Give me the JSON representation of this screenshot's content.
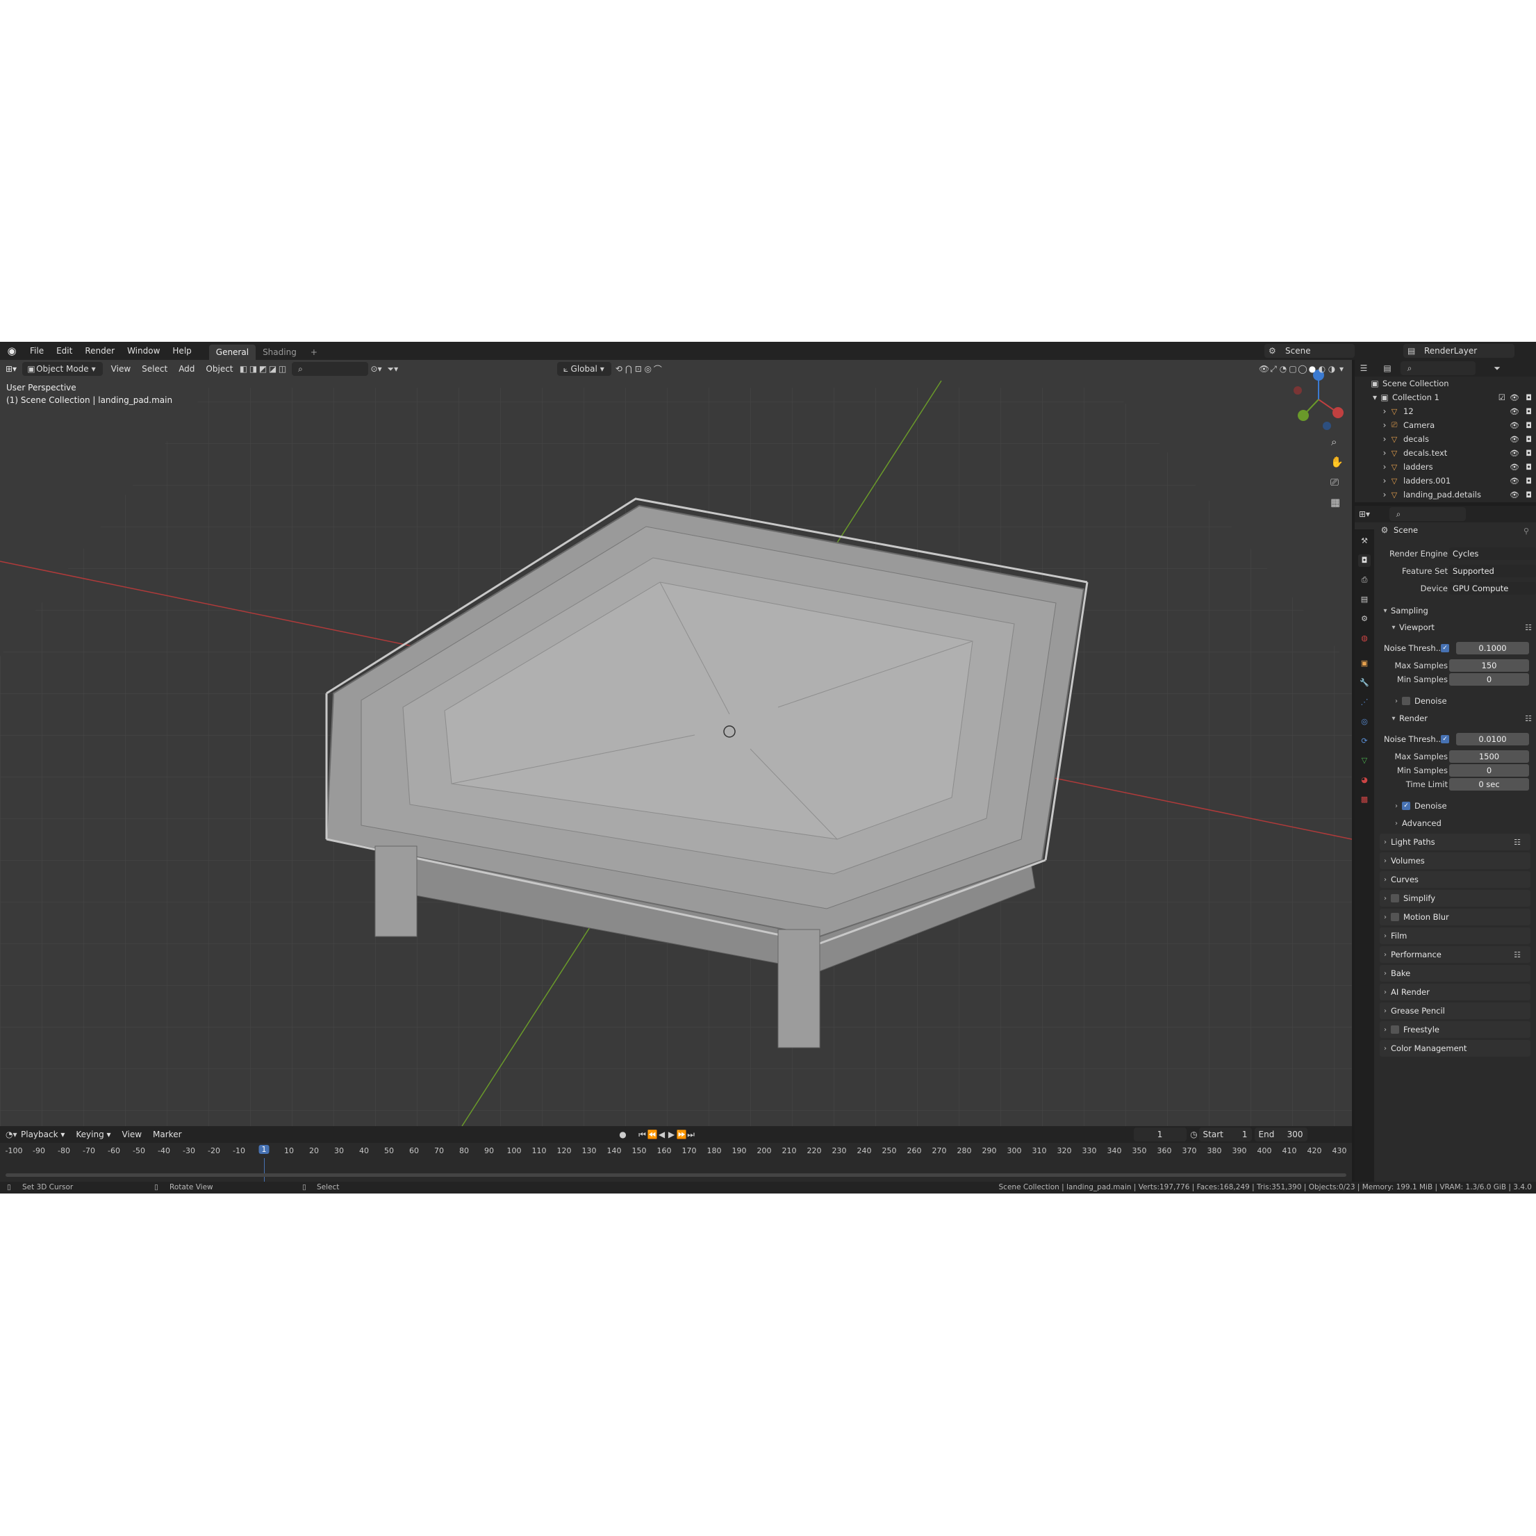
{
  "menu": {
    "file": "File",
    "edit": "Edit",
    "render": "Render",
    "window": "Window",
    "help": "Help",
    "tab_general": "General",
    "tab_shading": "Shading",
    "add_tab": "+",
    "scene_name": "Scene",
    "view_layer": "RenderLayer"
  },
  "viewport": {
    "mode": "Object Mode",
    "view": "View",
    "select": "Select",
    "add": "Add",
    "object": "Object",
    "transform_orientation": "Global",
    "perspective_label": "User Perspective",
    "collection_label": "(1) Scene Collection | landing_pad.main"
  },
  "outliner": {
    "root": "Scene Collection",
    "collection": "Collection 1",
    "items": [
      {
        "name": "12"
      },
      {
        "name": "Camera"
      },
      {
        "name": "decals"
      },
      {
        "name": "decals.text"
      },
      {
        "name": "ladders"
      },
      {
        "name": "ladders.001"
      },
      {
        "name": "landing_pad.details"
      },
      {
        "name": "landing_pad.main"
      }
    ]
  },
  "properties": {
    "context": "Scene",
    "render_engine_label": "Render Engine",
    "render_engine": "Cycles",
    "feature_set_label": "Feature Set",
    "feature_set": "Supported",
    "device_label": "Device",
    "device": "GPU Compute",
    "sampling": "Sampling",
    "viewport_section": "Viewport",
    "noise_threshold_label": "Noise Thresh...",
    "viewport_noise_threshold": "0.1000",
    "max_samples_label": "Max Samples",
    "viewport_max_samples": "150",
    "min_samples_label": "Min Samples",
    "viewport_min_samples": "0",
    "denoise_label": "Denoise",
    "render_section": "Render",
    "render_noise_threshold": "0.0100",
    "render_max_samples": "1500",
    "render_min_samples": "0",
    "time_limit_label": "Time Limit",
    "time_limit": "0 sec",
    "advanced": "Advanced",
    "panels": [
      "Light Paths",
      "Volumes",
      "Curves",
      "Simplify",
      "Motion Blur",
      "Film",
      "Performance",
      "Bake",
      "AI Render",
      "Grease Pencil",
      "Freestyle",
      "Color Management"
    ]
  },
  "timeline": {
    "playback": "Playback",
    "keying": "Keying",
    "view": "View",
    "marker": "Marker",
    "current_frame": "1",
    "start_label": "Start",
    "start": "1",
    "end_label": "End",
    "end": "300",
    "ticks": [
      "-100",
      "-90",
      "-80",
      "-70",
      "-60",
      "-50",
      "-40",
      "-30",
      "-20",
      "-10",
      "1",
      "10",
      "20",
      "30",
      "40",
      "50",
      "60",
      "70",
      "80",
      "90",
      "100",
      "110",
      "120",
      "130",
      "140",
      "150",
      "160",
      "170",
      "180",
      "190",
      "200",
      "210",
      "220",
      "230",
      "240",
      "250",
      "260",
      "270",
      "280",
      "290",
      "300",
      "310",
      "320",
      "330",
      "340",
      "350",
      "360",
      "370",
      "380",
      "390",
      "400",
      "410",
      "420",
      "430"
    ]
  },
  "status": {
    "left_action": "Set 3D Cursor",
    "middle_action": "Rotate View",
    "right_action": "Select",
    "info": "Scene Collection | landing_pad.main | Verts:197,776 | Faces:168,249 | Tris:351,390 | Objects:0/23 | Memory: 199.1 MiB | VRAM: 1.3/6.0 GiB | 3.4.0"
  },
  "colors": {
    "accent": "#4772b3",
    "x_axis": "#b03a3a",
    "y_axis": "#6a9a2a",
    "z_axis": "#3b7ad1",
    "viewport_bg": "#3d3d3d",
    "object_icon": "#e8a24e"
  }
}
